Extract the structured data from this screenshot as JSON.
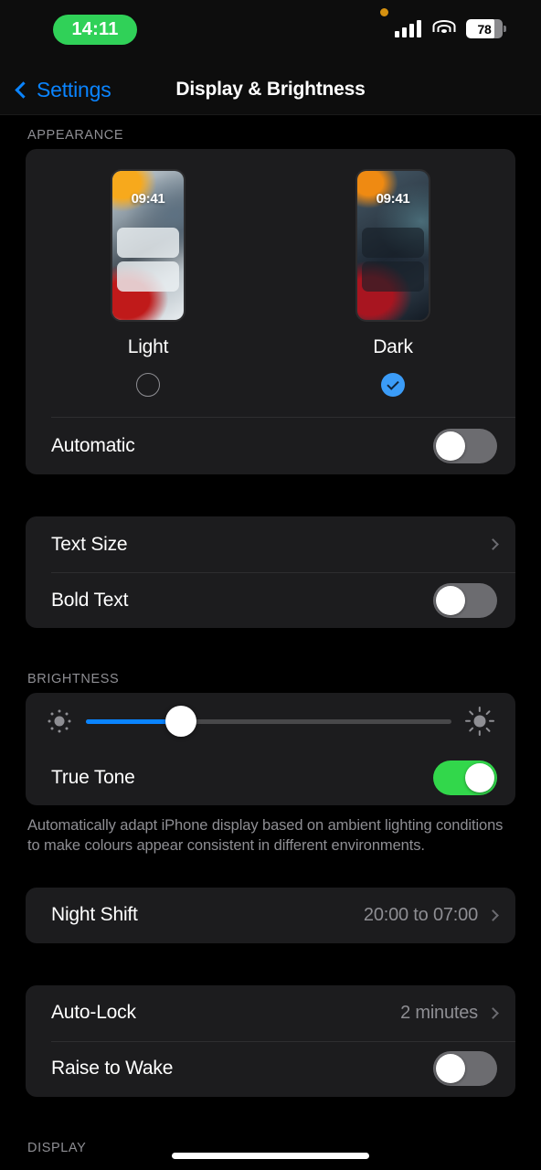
{
  "statusbar": {
    "time": "14:11",
    "battery_percent": "78",
    "signal_icon": "cellular-bars-icon",
    "wifi_icon": "wifi-icon",
    "battery_icon": "battery-icon",
    "privacy_icon": "privacy-indicator-dot",
    "time_pill_color": "#30d158"
  },
  "nav": {
    "back_label": "Settings",
    "title": "Display & Brightness",
    "accent": "#0a84ff"
  },
  "appearance": {
    "header": "APPEARANCE",
    "options": [
      {
        "name": "Light",
        "preview_time": "09:41",
        "selected": false
      },
      {
        "name": "Dark",
        "preview_time": "09:41",
        "selected": true
      }
    ],
    "automatic": {
      "label": "Automatic",
      "on": false
    }
  },
  "text_group": {
    "text_size": {
      "label": "Text Size"
    },
    "bold_text": {
      "label": "Bold Text",
      "on": false
    }
  },
  "brightness": {
    "header": "BRIGHTNESS",
    "slider_value": "26",
    "low_icon": "sun-small-icon",
    "high_icon": "sun-large-icon",
    "fill_color": "#0a84ff",
    "true_tone": {
      "label": "True Tone",
      "on": true
    },
    "footnote": "Automatically adapt iPhone display based on ambient lighting conditions to make colours appear consistent in different environments."
  },
  "night_shift": {
    "label": "Night Shift",
    "value": "20:00 to 07:00"
  },
  "lock_group": {
    "auto_lock": {
      "label": "Auto-Lock",
      "value": "2 minutes"
    },
    "raise_to_wake": {
      "label": "Raise to Wake",
      "on": false
    }
  },
  "display_section": {
    "header": "DISPLAY"
  }
}
